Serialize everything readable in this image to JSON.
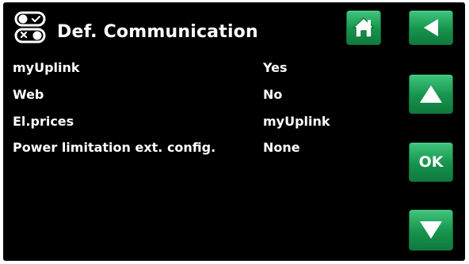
{
  "header": {
    "title": "Def. Communication",
    "icon": "toggle-switches-icon"
  },
  "settings": [
    {
      "label": "myUplink",
      "value": "Yes"
    },
    {
      "label": "Web",
      "value": "No"
    },
    {
      "label": "El.prices",
      "value": "myUplink"
    },
    {
      "label": "Power limitation ext. config.",
      "value": "None"
    }
  ],
  "nav": {
    "home_icon": "home-icon",
    "back_icon": "back-arrow-icon",
    "up_icon": "up-arrow-icon",
    "ok_label": "OK",
    "down_icon": "down-arrow-icon"
  },
  "colors": {
    "background": "#000000",
    "text": "#ffffff",
    "button_green": "#16934c"
  }
}
